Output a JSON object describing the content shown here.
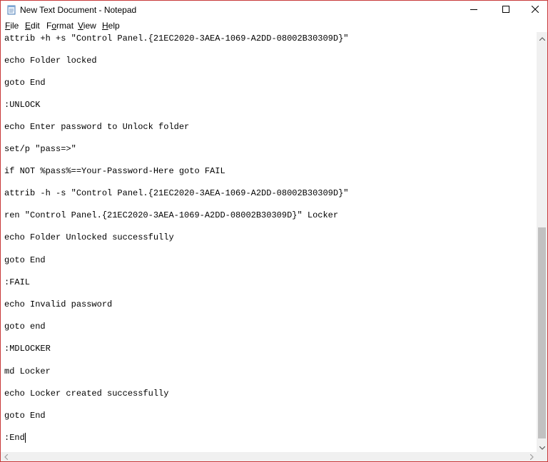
{
  "window": {
    "title": "New Text Document - Notepad",
    "icon": "notepad-icon",
    "controls": [
      "minimize-icon",
      "maximize-icon",
      "close-icon"
    ]
  },
  "menu": {
    "file": {
      "ul": "F",
      "rest": "ile"
    },
    "edit": {
      "ul": "E",
      "rest": "dit"
    },
    "format": {
      "pre": "F",
      "ul": "o",
      "rest": "rmat"
    },
    "view": {
      "ul": "V",
      "rest": "iew"
    },
    "help": {
      "ul": "H",
      "rest": "elp"
    }
  },
  "editor": {
    "lines": [
      "attrib +h +s \"Control Panel.{21EC2020-3AEA-1069-A2DD-08002B30309D}\"",
      "echo Folder locked",
      "goto End",
      ":UNLOCK",
      "echo Enter password to Unlock folder",
      "set/p \"pass=>\"",
      "if NOT %pass%==Your-Password-Here goto FAIL",
      "attrib -h -s \"Control Panel.{21EC2020-3AEA-1069-A2DD-08002B30309D}\"",
      "ren \"Control Panel.{21EC2020-3AEA-1069-A2DD-08002B30309D}\" Locker",
      "echo Folder Unlocked successfully",
      "goto End",
      ":FAIL",
      "echo Invalid password",
      "goto end",
      ":MDLOCKER",
      "md Locker",
      "echo Locker created successfully",
      "goto End",
      ":End"
    ]
  }
}
